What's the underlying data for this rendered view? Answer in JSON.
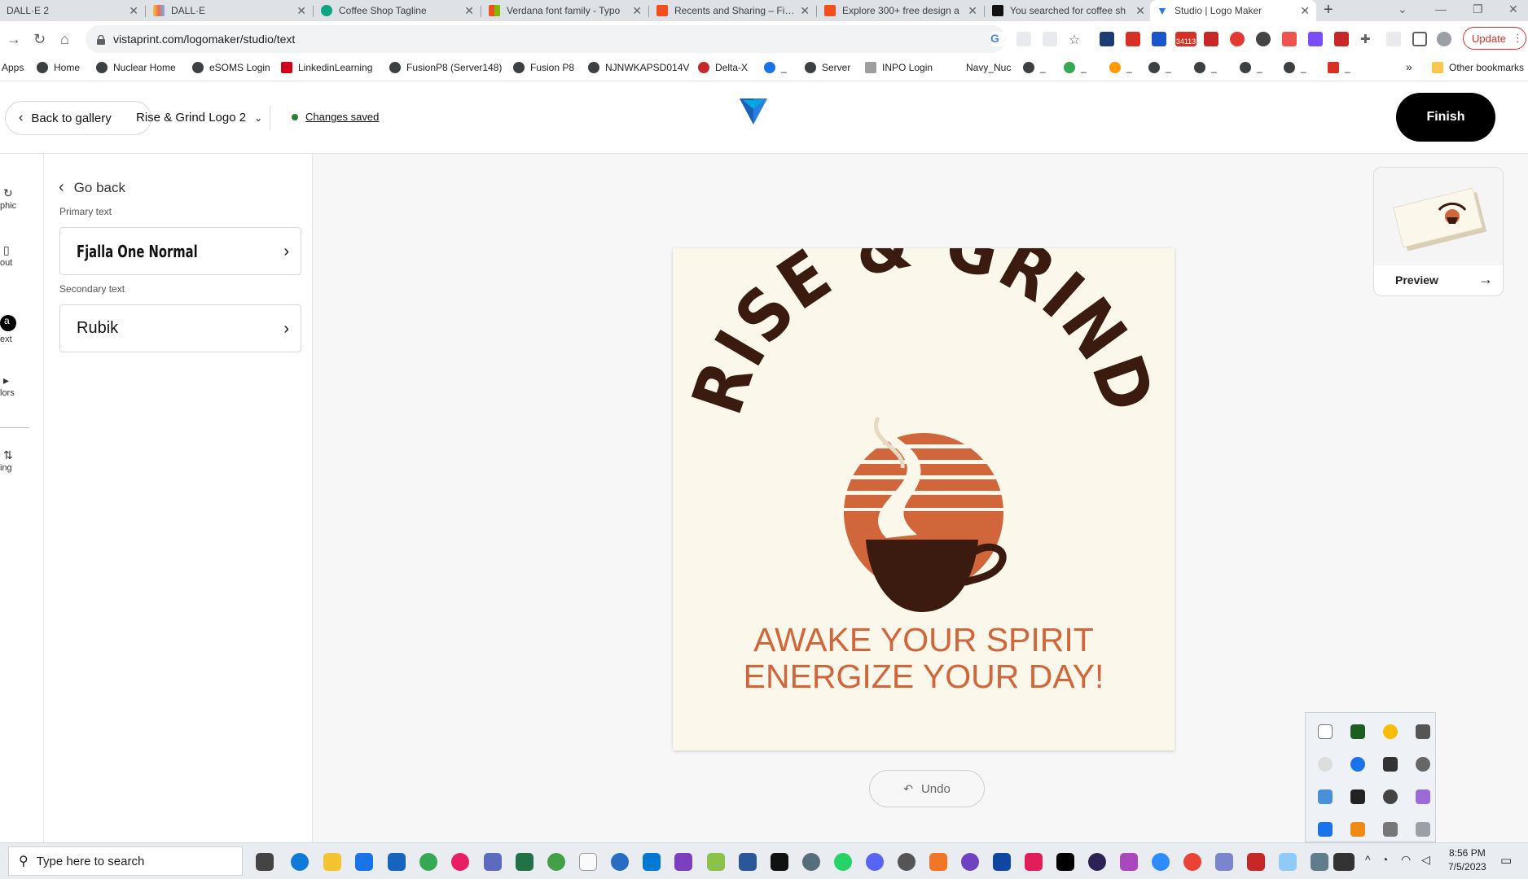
{
  "browser": {
    "tabs": [
      {
        "title": "DALL·E 2",
        "color": "#8a8a8a",
        "active": false
      },
      {
        "title": "DALL·E",
        "color": "#e86a5a",
        "active": false
      },
      {
        "title": "Coffee Shop Tagline",
        "color": "#10a37f",
        "active": false
      },
      {
        "title": "Verdana font family - Typo",
        "color": "#f25022",
        "active": false
      },
      {
        "title": "Recents and Sharing – Figm",
        "color": "#f24e1e",
        "active": false
      },
      {
        "title": "Explore 300+ free design a",
        "color": "#f24e1e",
        "active": false
      },
      {
        "title": "You searched for coffee sh",
        "color": "#111111",
        "active": false
      },
      {
        "title": "Studio | Logo Maker",
        "color": "#2a7de1",
        "active": true
      }
    ],
    "new_tab_symbol": "+",
    "url": "vistaprint.com/logomaker/studio/text",
    "update_label": "Update",
    "extension_badge": "34113",
    "bookmarks": [
      {
        "label": "Apps",
        "color": "#5f6368"
      },
      {
        "label": "Home",
        "color": "#3c4043"
      },
      {
        "label": "Nuclear Home",
        "color": "#3c4043"
      },
      {
        "label": "eSOMS Login",
        "color": "#3c4043"
      },
      {
        "label": "LinkedinLearning",
        "color": "#d0021b"
      },
      {
        "label": "FusionP8 (Server148)",
        "color": "#3c4043"
      },
      {
        "label": "Fusion P8",
        "color": "#3c4043"
      },
      {
        "label": "NJNWKAPSD014V",
        "color": "#3c4043"
      },
      {
        "label": "Delta-X",
        "color": "#c62828"
      },
      {
        "label": "_",
        "color": "#1a73e8"
      },
      {
        "label": "Server",
        "color": "#3c4043"
      },
      {
        "label": "INPO Login",
        "color": "#9e9e9e"
      },
      {
        "label": "Navy_Nuc",
        "color": "#ffffff"
      },
      {
        "label": "_",
        "color": "#3c4043"
      },
      {
        "label": "_",
        "color": "#34a853"
      },
      {
        "label": "_",
        "color": "#ff9900"
      },
      {
        "label": "_",
        "color": "#3c4043"
      },
      {
        "label": "_",
        "color": "#3c4043"
      },
      {
        "label": "_",
        "color": "#3c4043"
      },
      {
        "label": "_",
        "color": "#3c4043"
      },
      {
        "label": "_",
        "color": "#d93025"
      }
    ],
    "overflow_label": "»",
    "other_bookmarks_label": "Other bookmarks"
  },
  "app_header": {
    "back_label": "Back to gallery",
    "logo_name": "Rise & Grind Logo 2",
    "save_status": "Changes saved",
    "finish_label": "Finish",
    "accent_color": "#2a7de1"
  },
  "rail": {
    "items": [
      {
        "label": "phic",
        "icon": "graphic-icon",
        "glyph": "↻"
      },
      {
        "label": "out",
        "icon": "layout-icon",
        "glyph": "▯"
      },
      {
        "label": "ext",
        "icon": "text-icon",
        "glyph": "a"
      },
      {
        "label": "lors",
        "icon": "colors-icon",
        "glyph": "▸"
      },
      {
        "label": "ing",
        "icon": "spacing-icon",
        "glyph": "⇅"
      }
    ]
  },
  "panel": {
    "go_back_label": "Go back",
    "primary_label": "Primary text",
    "primary_font": "Fjalla One Normal",
    "secondary_label": "Secondary text",
    "secondary_font": "Rubik"
  },
  "logo": {
    "title": "RISE & GRIND",
    "tagline_line1": "AWAKE YOUR SPIRIT",
    "tagline_line2": "ENERGIZE YOUR DAY!",
    "title_color": "#3b1a10",
    "tagline_color": "#d0663a",
    "sun_color": "#d0663a",
    "cup_color": "#3b1a10",
    "steam_color": "#fbf7ea",
    "background": "#fbf7ea"
  },
  "canvas": {
    "undo_label": "Undo",
    "preview_label": "Preview"
  },
  "taskbar": {
    "search_placeholder": "Type here to search",
    "time": "8:56 PM",
    "date": "7/5/2023"
  }
}
